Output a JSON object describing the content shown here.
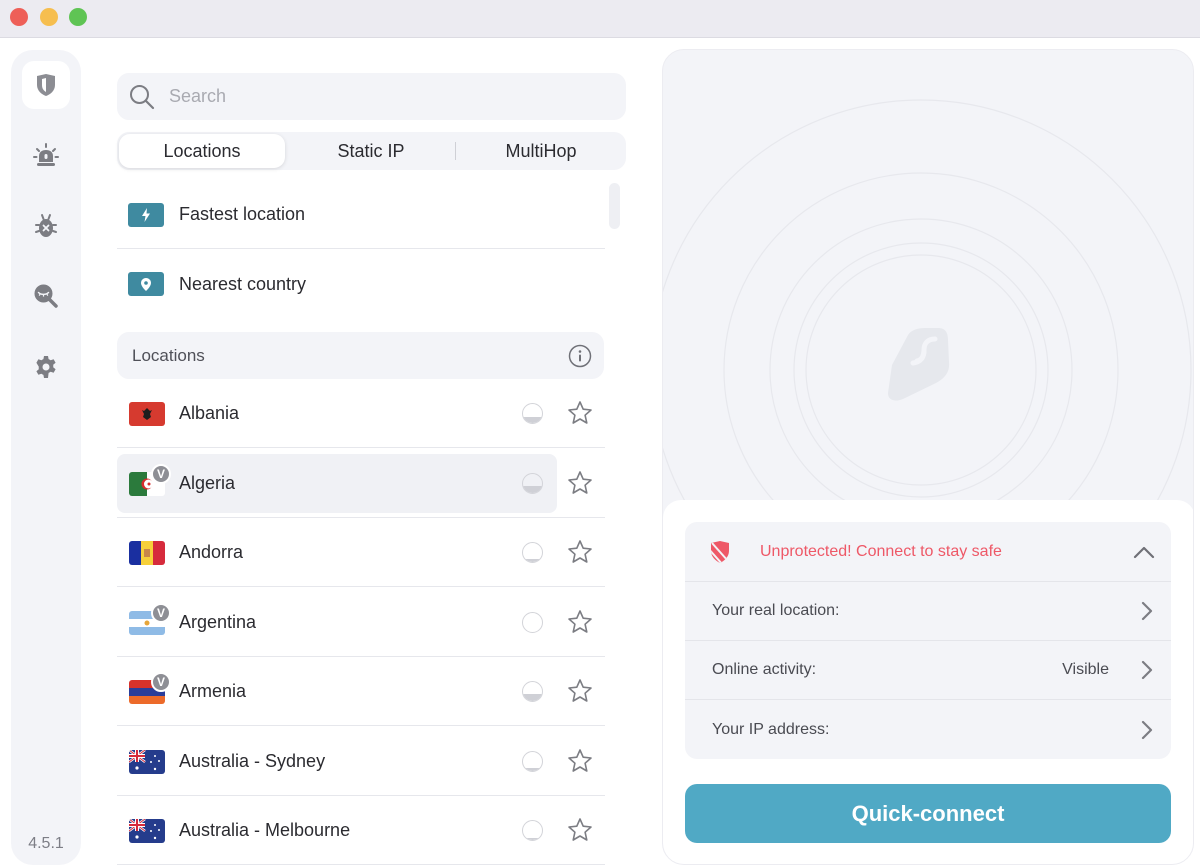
{
  "window": {
    "controls": [
      "close",
      "minimize",
      "zoom"
    ]
  },
  "sidebar": {
    "items": [
      {
        "name": "vpn",
        "icon": "shield-icon",
        "active": true
      },
      {
        "name": "alert",
        "icon": "alert-siren-icon",
        "active": false
      },
      {
        "name": "antivirus",
        "icon": "bug-icon",
        "active": false
      },
      {
        "name": "search",
        "icon": "private-search-icon",
        "active": false
      },
      {
        "name": "settings",
        "icon": "gear-icon",
        "active": false
      }
    ],
    "version": "4.5.1"
  },
  "search": {
    "placeholder": "Search",
    "value": ""
  },
  "tabs": [
    {
      "label": "Locations",
      "active": true
    },
    {
      "label": "Static IP",
      "active": false
    },
    {
      "label": "MultiHop",
      "active": false
    }
  ],
  "quick": {
    "fastest": {
      "label": "Fastest location",
      "icon": "lightning-icon"
    },
    "nearest": {
      "label": "Nearest country",
      "icon": "location-pin-icon"
    }
  },
  "section": {
    "title": "Locations",
    "info_icon": "info-icon"
  },
  "locations": [
    {
      "name": "Albania",
      "flag": "AL",
      "virtual": false,
      "load": 0.3,
      "favorite": false,
      "selected": false
    },
    {
      "name": "Algeria",
      "flag": "DZ",
      "virtual": true,
      "load": 0.35,
      "favorite": false,
      "selected": true
    },
    {
      "name": "Andorra",
      "flag": "AD",
      "virtual": false,
      "load": 0.15,
      "favorite": false,
      "selected": false
    },
    {
      "name": "Argentina",
      "flag": "AR",
      "virtual": true,
      "load": 0.0,
      "favorite": false,
      "selected": false
    },
    {
      "name": "Armenia",
      "flag": "AM",
      "virtual": true,
      "load": 0.35,
      "favorite": false,
      "selected": false
    },
    {
      "name": "Australia - Sydney",
      "flag": "AU",
      "virtual": false,
      "load": 0.15,
      "favorite": false,
      "selected": false
    },
    {
      "name": "Australia - Melbourne",
      "flag": "AU",
      "virtual": false,
      "load": 0.1,
      "favorite": false,
      "selected": false
    }
  ],
  "virtual_badge": "V",
  "status": {
    "warning": "Unprotected! Connect to stay safe",
    "warning_color": "#ee5867",
    "rows": [
      {
        "label": "Your real location:",
        "value": ""
      },
      {
        "label": "Online activity:",
        "value": "Visible"
      },
      {
        "label": "Your IP address:",
        "value": ""
      }
    ]
  },
  "quick_connect": {
    "label": "Quick-connect",
    "color": "#50a9c5"
  }
}
